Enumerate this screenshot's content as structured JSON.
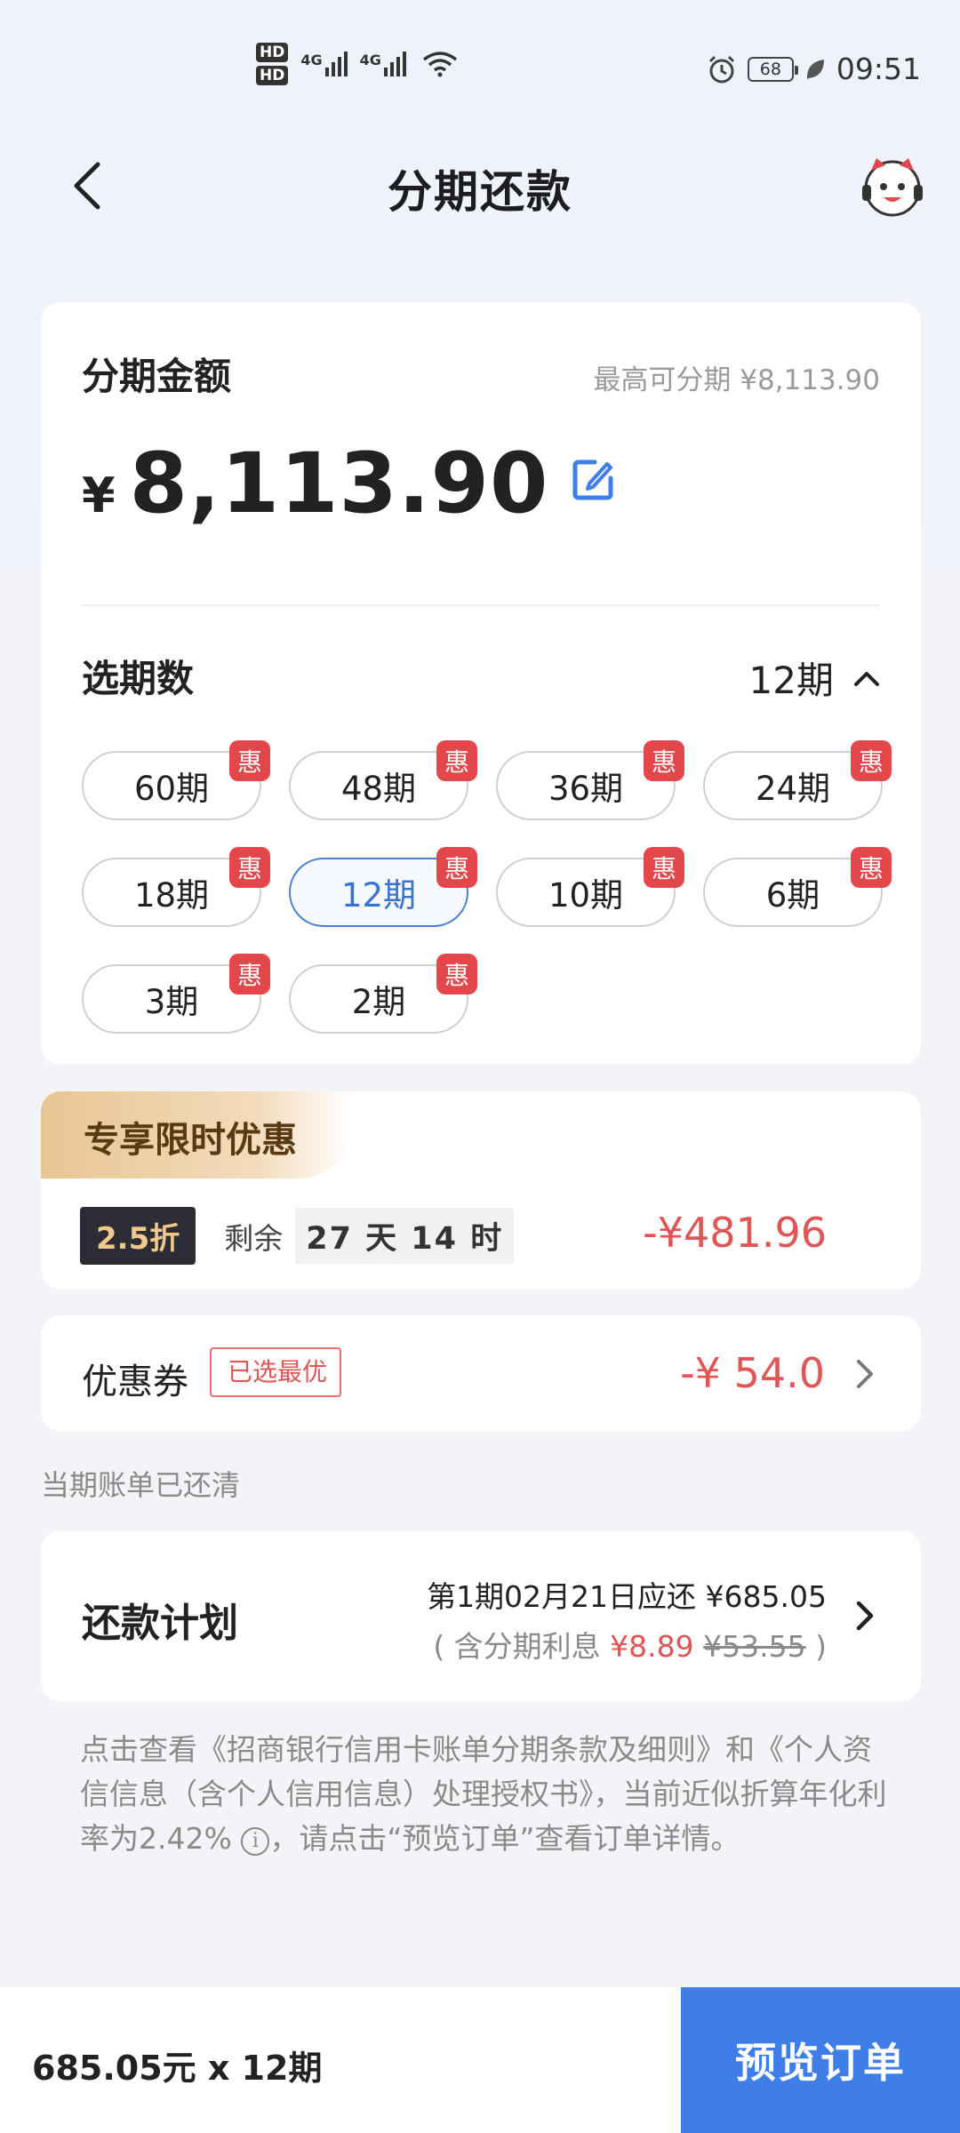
{
  "status_bar": {
    "hd1": "HD",
    "hd2": "HD",
    "net1": "4G",
    "net2": "4G",
    "battery": "68",
    "time": "09:51"
  },
  "header": {
    "title": "分期还款"
  },
  "amount_card": {
    "label": "分期金额",
    "max_text": "最高可分期 ¥8,113.90",
    "currency": "¥",
    "amount": "8,113.90"
  },
  "period": {
    "label": "选期数",
    "selected": "12期",
    "badge": "惠",
    "options": [
      "60期",
      "48期",
      "36期",
      "24期",
      "18期",
      "12期",
      "10期",
      "6期",
      "3期",
      "2期"
    ]
  },
  "promo": {
    "title": "专享限时优惠",
    "discount": "2.5折",
    "remain_label": "剩余",
    "remain_time": "27 天 14 时",
    "amount": "-¥481.96"
  },
  "coupon": {
    "label": "优惠券",
    "tag": "已选最优",
    "amount": "-¥ 54.0"
  },
  "bill_status": "当期账单已还清",
  "plan": {
    "label": "还款计划",
    "line1": "第1期02月21日应还 ¥685.05",
    "line2_prefix": "( 含分期利息 ",
    "interest": "¥8.89",
    "original_interest": "¥53.55",
    "line2_suffix": " )"
  },
  "disclaimer": {
    "text_before": "点击查看《招商银行信用卡账单分期条款及细则》和《个人资信信息（含个人信用信息）处理授权书》，当前近似折算年化利率为2.42%",
    "info": "i",
    "text_after": "，请点击“预览订单”查看订单详情。"
  },
  "bottom": {
    "summary": "685.05元 x 12期",
    "button": "预览订单"
  },
  "colors": {
    "accent_blue": "#3f7ee8",
    "discount_red": "#e05555",
    "badge_red": "#e2484b"
  }
}
